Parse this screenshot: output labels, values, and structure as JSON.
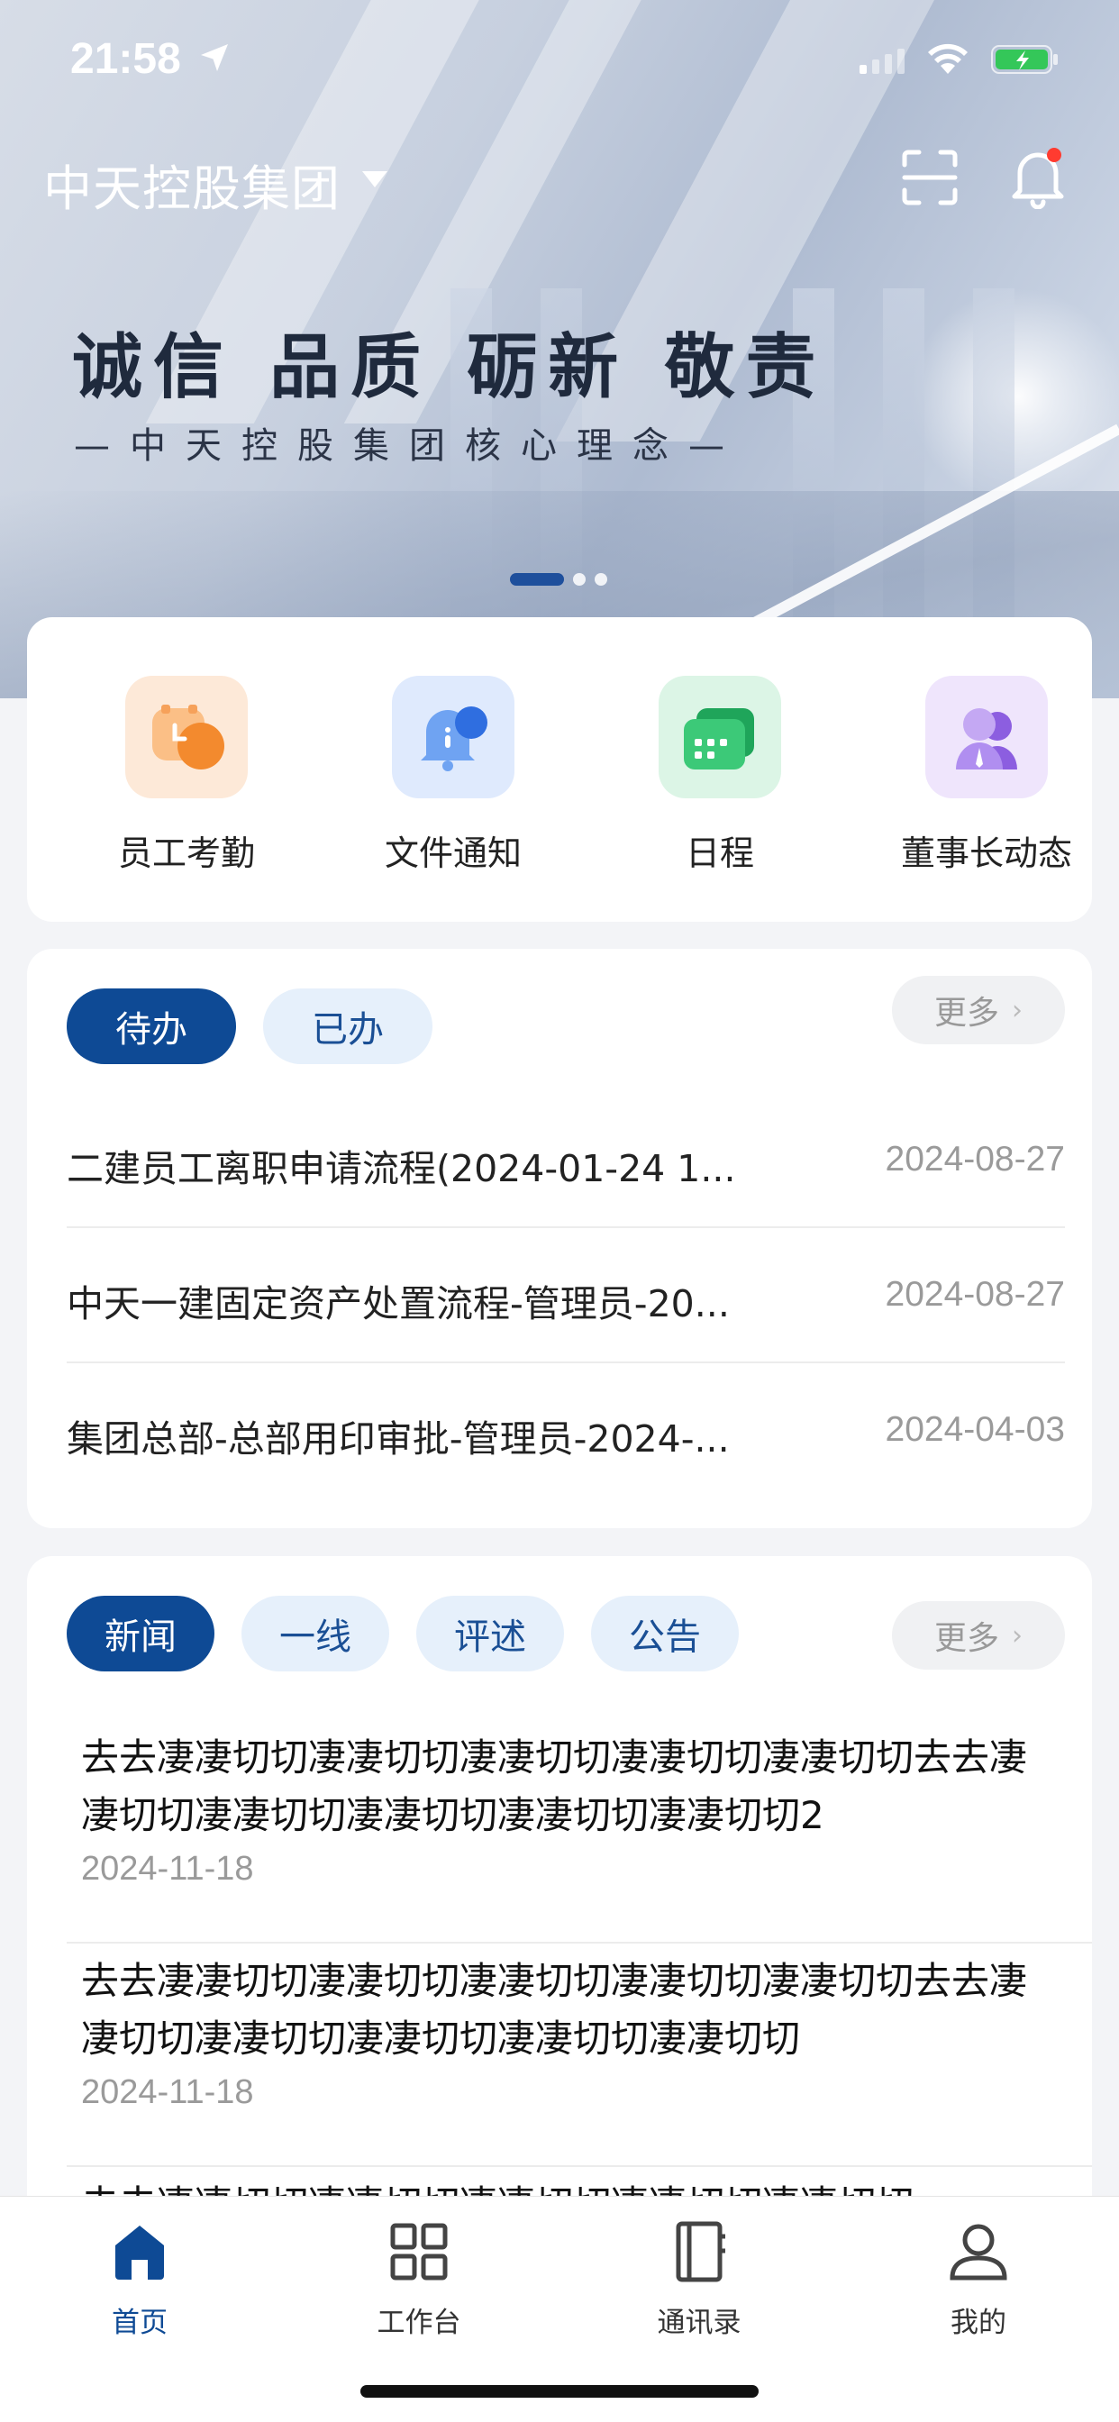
{
  "status_bar": {
    "time": "21:58"
  },
  "header": {
    "company": "中天控股集团"
  },
  "banner": {
    "slogan": "诚信 品质 砺新 敬责",
    "subtitle": "—中天控股集团核心理念—"
  },
  "quick_actions": [
    {
      "label": "员工考勤",
      "icon": "attendance-clock-icon",
      "color": "#f9a25a"
    },
    {
      "label": "文件通知",
      "icon": "notification-bell-icon",
      "color": "#3f7be6"
    },
    {
      "label": "日程",
      "icon": "calendar-icon",
      "color": "#2fb86b"
    },
    {
      "label": "董事长动态",
      "icon": "chairman-person-icon",
      "color": "#9a6ce8"
    }
  ],
  "todo": {
    "tabs": [
      "待办",
      "已办"
    ],
    "more": "更多",
    "items": [
      {
        "title": "二建员工离职申请流程(2024-01-24 1...",
        "date": "2024-08-27"
      },
      {
        "title": "中天一建固定资产处置流程-管理员-20...",
        "date": "2024-08-27"
      },
      {
        "title": "集团总部-总部用印审批-管理员-2024-...",
        "date": "2024-04-03"
      }
    ]
  },
  "news": {
    "tabs": [
      "新闻",
      "一线",
      "评述",
      "公告"
    ],
    "more": "更多",
    "items": [
      {
        "title": "去去凄凄切切凄凄切切凄凄切切凄凄切切凄凄切切去去凄凄切切凄凄切切凄凄切切凄凄切切凄凄切切2",
        "date": "2024-11-18"
      },
      {
        "title": "去去凄凄切切凄凄切切凄凄切切凄凄切切凄凄切切去去凄凄切切凄凄切切凄凄切切凄凄切切凄凄切切",
        "date": "2024-11-18"
      },
      {
        "title": "去去凄凄切切凄凄切切凄凄切切凄凄切切凄凄切切",
        "date": ""
      }
    ]
  },
  "tabbar": [
    {
      "label": "首页",
      "icon": "home-icon",
      "active": true
    },
    {
      "label": "工作台",
      "icon": "workbench-grid-icon",
      "active": false
    },
    {
      "label": "通讯录",
      "icon": "contacts-book-icon",
      "active": false
    },
    {
      "label": "我的",
      "icon": "profile-person-icon",
      "active": false
    }
  ],
  "colors": {
    "primary": "#0e4a95",
    "pill_inactive": "#e6f0fb",
    "badge": "#ff3b30"
  }
}
